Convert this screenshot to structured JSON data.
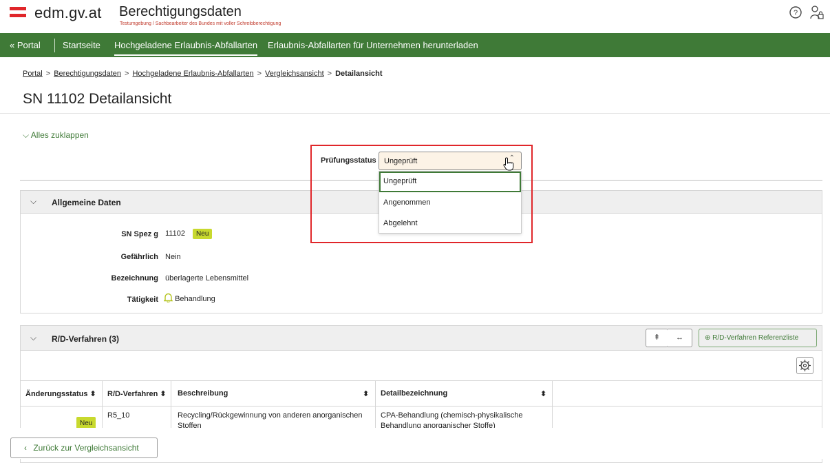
{
  "header": {
    "brand": "edm.gv.at",
    "title": "Berechtigungsdaten",
    "subtitle": "Testumgebung / Sachbearbeiter des Bundes mit voller Schreibberechtigung",
    "flag_colors": [
      "#e0262a",
      "#ffffff",
      "#e0262a"
    ]
  },
  "nav": {
    "portal": "« Portal",
    "items": [
      "Startseite",
      "Hochgeladene Erlaubnis-Abfallarten",
      "Erlaubnis-Abfallarten für Unternehmen herunterladen"
    ]
  },
  "breadcrumb": {
    "items": [
      "Portal",
      "Berechtigungsdaten",
      "Hochgeladene Erlaubnis-Abfallarten",
      "Vergleichsansicht"
    ],
    "current": "Detailansicht",
    "separator": ">"
  },
  "page": {
    "title": "SN 11102 Detailansicht",
    "collapse_all": "Alles zuklappen"
  },
  "pruefungsstatus": {
    "label": "Prüfungsstatus",
    "value": "Ungeprüft",
    "options": [
      "Ungeprüft",
      "Angenommen",
      "Abgelehnt"
    ],
    "selected_index": 0
  },
  "allgemeine_daten": {
    "title": "Allgemeine Daten",
    "fields": [
      {
        "label": "SN Spez g",
        "value": "11102",
        "badge": "Neu"
      },
      {
        "label": "Gefährlich",
        "value": "Nein"
      },
      {
        "label": "Bezeichnung",
        "value": "überlagerte Lebensmittel"
      },
      {
        "label": "Tätigkeit",
        "value": "Behandlung",
        "icon": "bell-icon"
      }
    ]
  },
  "rd_verfahren": {
    "title": "R/D-Verfahren (3)",
    "ref_button": "R/D-Verfahren Referenzliste",
    "columns": [
      "Änderungsstatus",
      "R/D-Verfahren",
      "Beschreibung",
      "Detailbezeichnung"
    ],
    "rows": [
      {
        "status": "Neu",
        "code": "R5_10",
        "beschreibung": "Recycling/Rückgewinnung von anderen anorganischen Stoffen",
        "detail": "CPA-Behandlung (chemisch-physikalische Behandlung anorganischer Stoffe)"
      }
    ]
  },
  "footer": {
    "back_label": "Zurück zur Vergleichsansicht"
  },
  "colors": {
    "nav_green": "#3f7a37",
    "highlight_red": "#e0262a",
    "badge_lime": "#c8d92e",
    "select_bg": "#fcf3e6"
  }
}
